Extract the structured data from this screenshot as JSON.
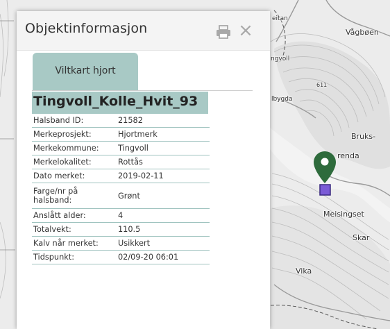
{
  "panel": {
    "title": "Objektinformasjon",
    "print_icon": "printer-icon",
    "close_label": "×",
    "tab_label": "Viltkart hjort",
    "object_name": "Tingvoll_Kolle_Hvit_93"
  },
  "attributes": [
    {
      "key": "Halsband ID:",
      "value": "21582"
    },
    {
      "key": "Merkeprosjekt:",
      "value": "Hjortmerk"
    },
    {
      "key": "Merkekommune:",
      "value": "Tingvoll"
    },
    {
      "key": "Merkelokalitet:",
      "value": "Rottås"
    },
    {
      "key": "Dato merket:",
      "value": "2019-02-11"
    },
    {
      "key": "Farge/nr på halsband:",
      "value": "Grønt"
    },
    {
      "key": "Anslått alder:",
      "value": "4"
    },
    {
      "key": "Totalvekt:",
      "value": "110.5"
    },
    {
      "key": "Kalv når merket:",
      "value": "Usikkert"
    },
    {
      "key": "Tidspunkt:",
      "value": "02/09-20 06:01"
    }
  ],
  "map": {
    "labels": {
      "eitan": "eitan",
      "vagboen": "Vågbøen",
      "ngvoll": "ngvoll",
      "elev": "611",
      "lbygda": "lbygda",
      "bruks": "Bruks-",
      "renda": "renda",
      "meisingset": "Meisingset",
      "skar": "Skar",
      "vika": "Vika"
    },
    "marker_icon": "map-pin-icon",
    "marker_color": "#2e6b3c",
    "point_color": "#7b5bd6"
  },
  "colors": {
    "accent": "#a8c9c5",
    "table_line": "#9fc3bf"
  }
}
